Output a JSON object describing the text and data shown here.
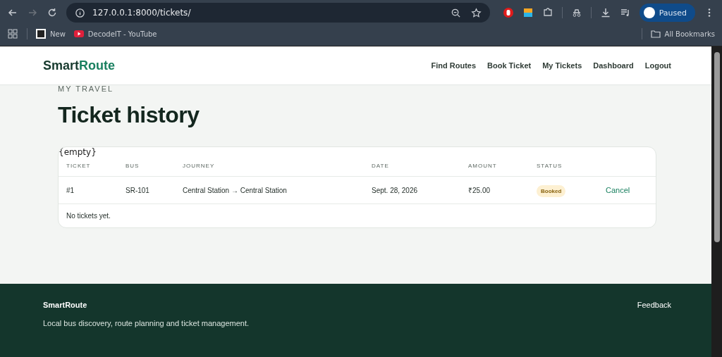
{
  "browser": {
    "url": "127.0.0.1:8000/tickets/",
    "profile": "Paused",
    "bookmarks": [
      {
        "label": "New",
        "kind": "page"
      },
      {
        "label": "DecodeIT - YouTube",
        "kind": "video"
      }
    ],
    "all_bookmarks": "All Bookmarks"
  },
  "header": {
    "brand_first": "Smart",
    "brand_second": "Route",
    "nav": [
      "Find Routes",
      "Book Ticket",
      "My Tickets",
      "Dashboard",
      "Logout"
    ]
  },
  "page": {
    "eyebrow": "MY TRAVEL",
    "title": "Ticket history"
  },
  "table": {
    "debug_text": "{empty}",
    "columns": [
      "TICKET",
      "BUS",
      "JOURNEY",
      "DATE",
      "AMOUNT",
      "STATUS"
    ],
    "rows": [
      {
        "ticket": "#1",
        "bus": "SR-101",
        "journey": "Central Station → Central Station",
        "date": "Sept. 28, 2026",
        "amount": "₹25.00",
        "status": "Booked",
        "action": "Cancel"
      }
    ],
    "empty_text": "No tickets yet."
  },
  "footer": {
    "brand": "SmartRoute",
    "tagline": "Local bus discovery, route planning and ticket management.",
    "link": "Feedback"
  }
}
